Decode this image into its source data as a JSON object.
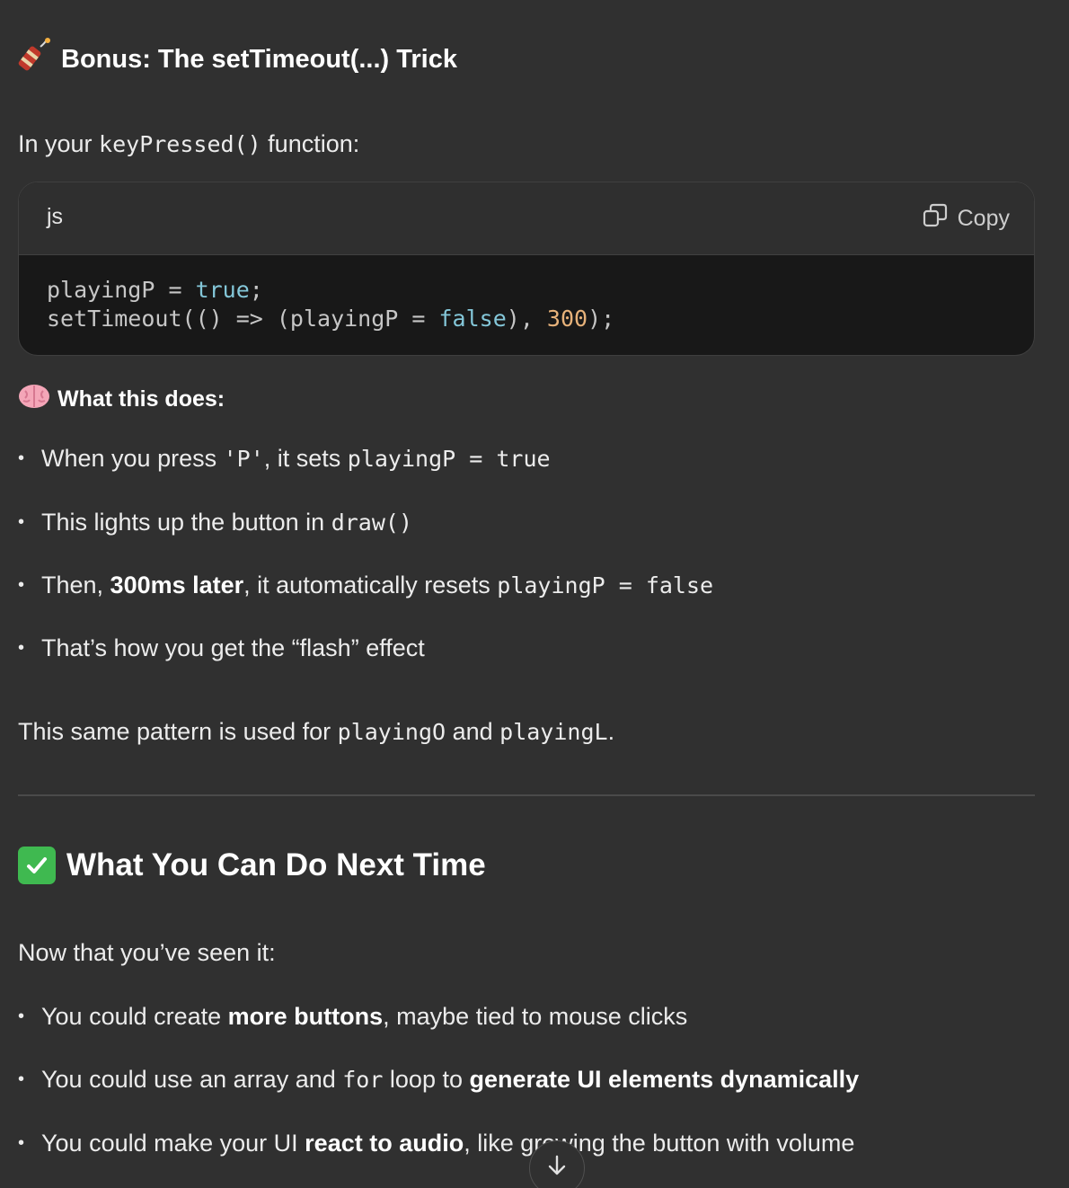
{
  "bonus_heading": {
    "icon": "firecracker-icon",
    "text": "Bonus: The setTimeout(...) Trick"
  },
  "intro": {
    "before": "In your ",
    "code": "keyPressed()",
    "after": " function:"
  },
  "code_block": {
    "language": "js",
    "copy_label": "Copy",
    "line1": {
      "var": "playingP = ",
      "bool": "true",
      "end": ";"
    },
    "line2": {
      "a": "setTimeout(() => (playingP = ",
      "bool": "false",
      "b": "), ",
      "num": "300",
      "end": ");"
    },
    "colors": {
      "background": "#181818",
      "header": "#2f2f2f",
      "keyword": "#84c7d9",
      "number": "#e7b27a"
    }
  },
  "what_this_does": {
    "icon": "brain-icon",
    "title": "What this does:",
    "items": [
      {
        "t1": "When you press ",
        "c1": "'P'",
        "t2": ", it sets ",
        "c2": "playingP = true"
      },
      {
        "t1": "This lights up the button in ",
        "c1": "draw()"
      },
      {
        "t1": "Then, ",
        "b1": "300ms later",
        "t2": ", it automatically resets ",
        "c1": "playingP = false"
      },
      {
        "t1": "That’s how you get the “flash” effect"
      }
    ]
  },
  "same_pattern": {
    "t1": "This same pattern is used for ",
    "c1": "playingO",
    "t2": " and ",
    "c2": "playingL",
    "t3": "."
  },
  "next_heading": {
    "icon": "check-mark-icon",
    "text": "What You Can Do Next Time"
  },
  "now_that": "Now that you’ve seen it:",
  "next_items": [
    {
      "t1": "You could create ",
      "b1": "more buttons",
      "t2": ", maybe tied to mouse clicks"
    },
    {
      "t1": "You could use an array and ",
      "c1": "for",
      "t2": " loop to ",
      "b1": "generate UI elements dynamically"
    },
    {
      "t1": "You could make your UI ",
      "b1": "react to audio",
      "t2": ", like growing the button with volume"
    }
  ],
  "scroll_button": {
    "icon": "arrow-down-icon"
  }
}
